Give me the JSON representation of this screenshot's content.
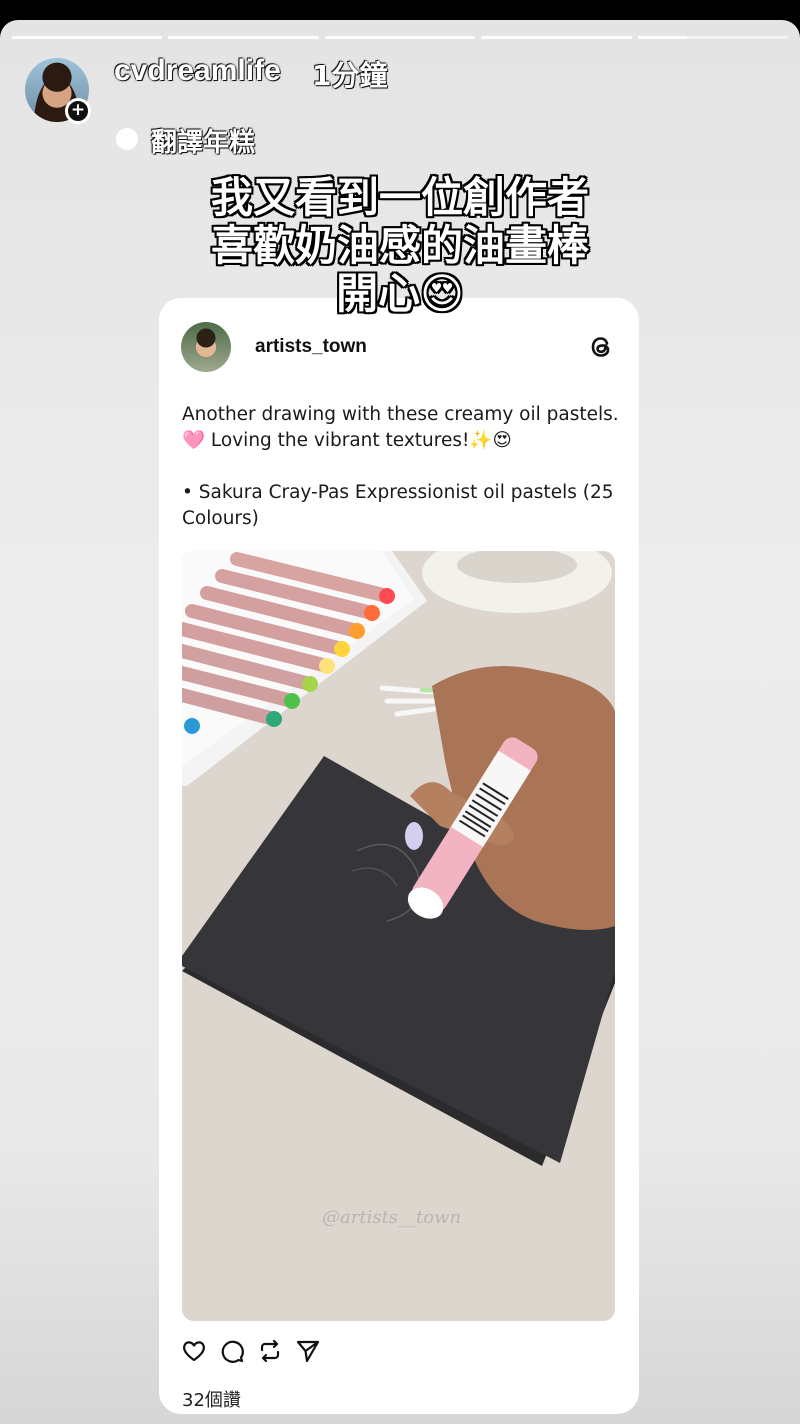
{
  "story": {
    "segments": [
      1,
      1,
      1,
      1,
      0.33
    ],
    "username": "cvdreamlife",
    "time": "1分鐘",
    "translate_label": "翻譯年糕",
    "caption_lines": [
      "我又看到一位創作者",
      "喜歡奶油感的油畫棒",
      "開心😍"
    ]
  },
  "post": {
    "username": "artists_town",
    "text_line1": "Another drawing with these creamy oil pastels.",
    "text_line1_heart": "🩷",
    "text_line1_rest": " Loving the vibrant textures!",
    "text_line1_sparkle": "✨",
    "text_line1_face": "😍",
    "text_line2": "• Sakura Cray-Pas Expressionist oil pastels (25 Colours)",
    "watermark": "@artists__town",
    "likes": "32個讚"
  },
  "icons": {
    "threads": "threads-logo-icon",
    "like": "heart-icon",
    "comment": "comment-icon",
    "repost": "repost-icon",
    "share": "send-icon"
  }
}
